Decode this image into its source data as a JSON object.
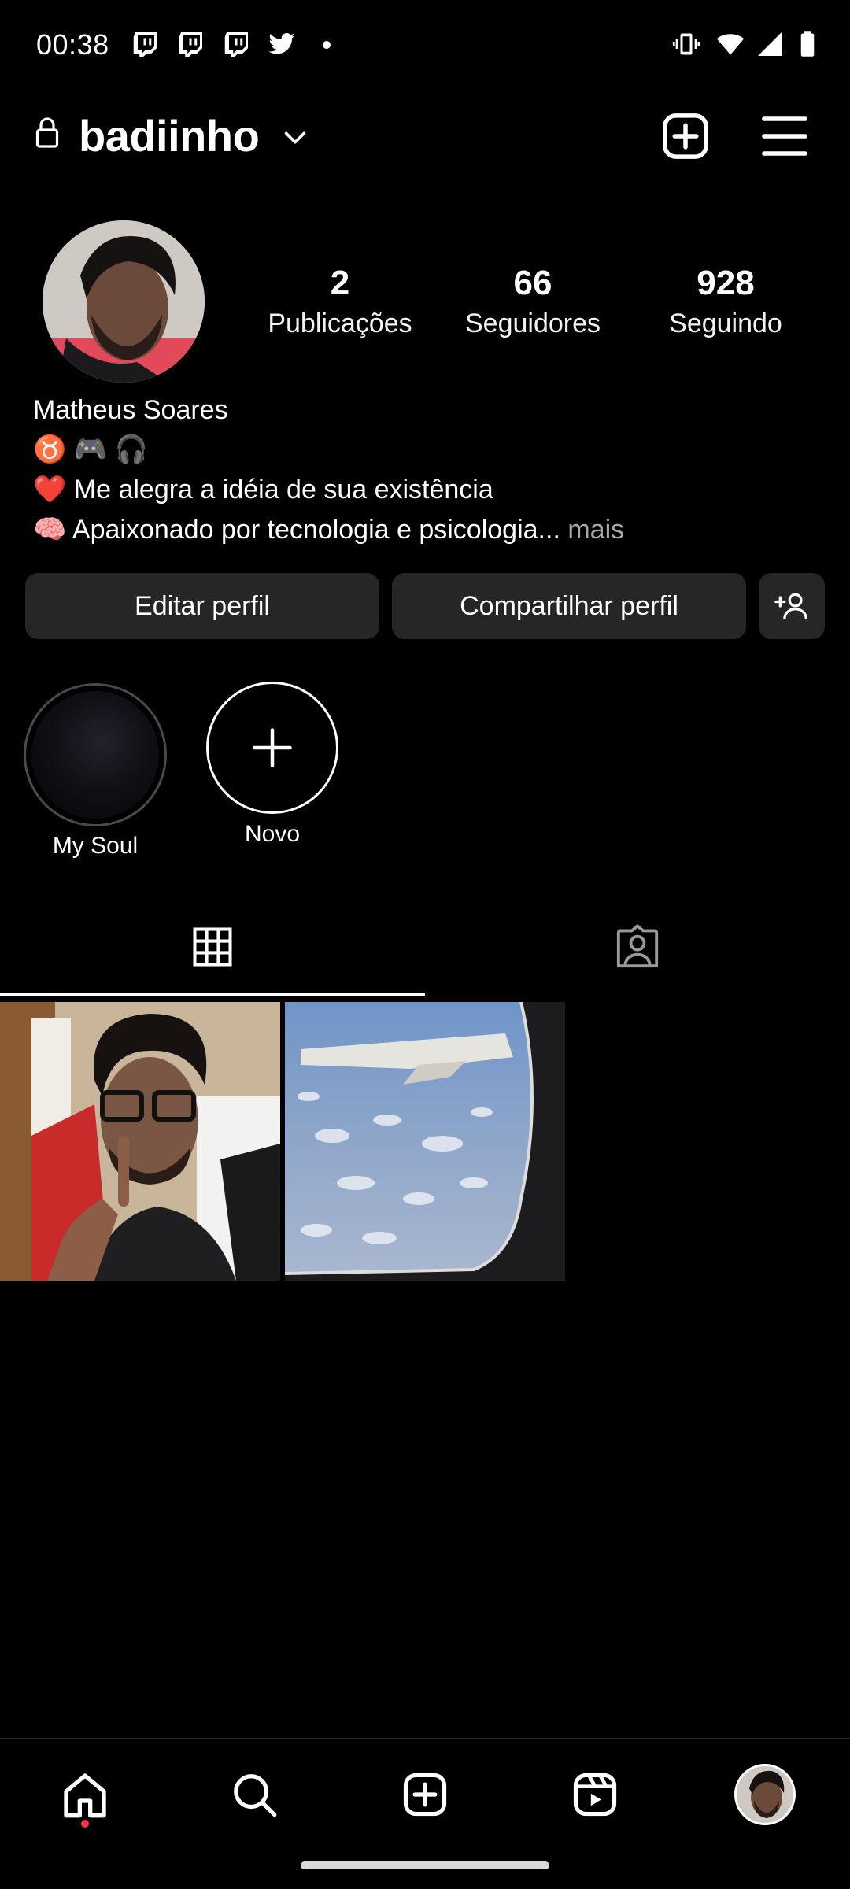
{
  "status_bar": {
    "time": "00:38",
    "notification_icons": [
      "twitch-icon",
      "twitch-icon",
      "twitch-icon",
      "twitter-icon",
      "more-dot-icon"
    ],
    "system_icons": [
      "vibrate-icon",
      "wifi-icon",
      "signal-icon",
      "battery-icon"
    ]
  },
  "header": {
    "username": "badiinho",
    "icons": [
      "lock-icon",
      "chevron-down-icon",
      "new-post-icon",
      "menu-icon"
    ]
  },
  "profile": {
    "name": "Matheus Soares",
    "bio_line1": "♉ 🎮 🎧",
    "bio_line2": "❤️ Me alegra a idéia de sua existência",
    "bio_line3": "🧠 Apaixonado por tecnologia e psicologia...",
    "bio_more": "mais",
    "stats": [
      {
        "number": "2",
        "label": "Publicações"
      },
      {
        "number": "66",
        "label": "Seguidores"
      },
      {
        "number": "928",
        "label": "Seguindo"
      }
    ]
  },
  "actions": {
    "edit_label": "Editar perfil",
    "share_label": "Compartilhar perfil",
    "discover_icon": "add-person-icon"
  },
  "highlights": [
    {
      "label": "My Soul"
    },
    {
      "label": "Novo"
    }
  ],
  "tabs": [
    "grid-icon",
    "tagged-icon"
  ],
  "active_tab": "grid-icon",
  "posts": [
    "selfie photo",
    "airplane window photo"
  ],
  "bottom_nav": [
    "home-icon",
    "search-icon",
    "create-icon",
    "reels-icon",
    "profile-avatar"
  ],
  "colors": {
    "background": "#000000",
    "button": "#262626",
    "muted": "#a8a8a8",
    "notification_dot": "#ff3040"
  }
}
